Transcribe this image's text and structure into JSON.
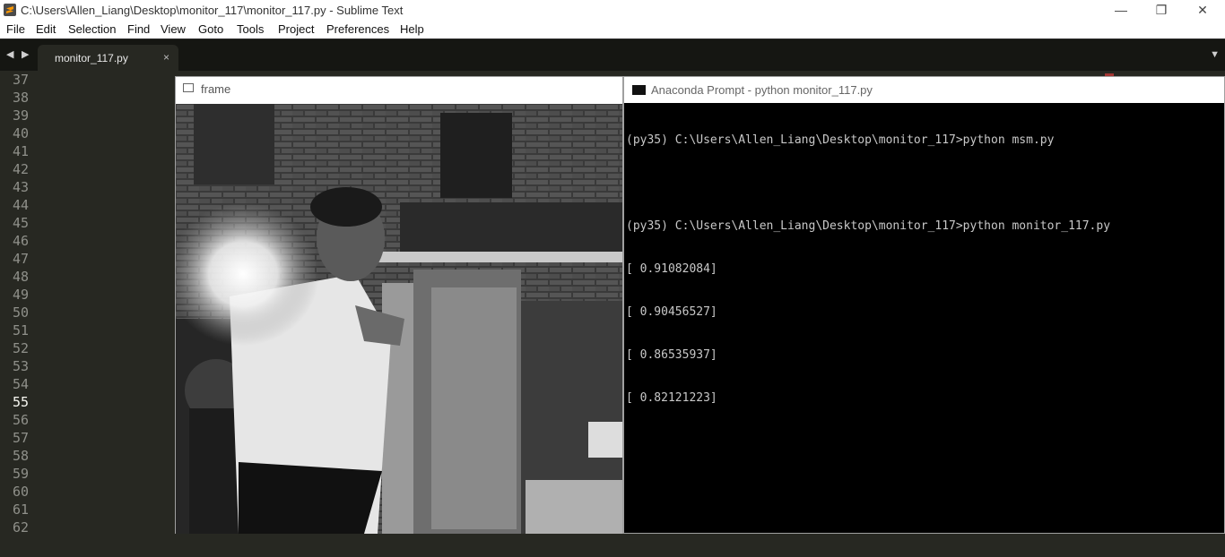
{
  "window": {
    "title": "C:\\Users\\Allen_Liang\\Desktop\\monitor_117\\monitor_117.py - Sublime Text",
    "controls": {
      "minimize": "—",
      "maximize": "❐",
      "close": "✕"
    }
  },
  "menu": [
    "File",
    "Edit",
    "Selection",
    "Find",
    "View",
    "Goto",
    "Tools",
    "Project",
    "Preferences",
    "Help"
  ],
  "tabs": {
    "nav_left": "◀",
    "nav_right": "▶",
    "active_tab": "monitor_117.py",
    "close_glyph": "×",
    "dropdown": "▼"
  },
  "editor": {
    "line_numbers": [
      "37",
      "38",
      "39",
      "40",
      "41",
      "42",
      "43",
      "44",
      "45",
      "46",
      "47",
      "48",
      "49",
      "50",
      "51",
      "52",
      "53",
      "54",
      "55",
      "56",
      "57",
      "58",
      "59",
      "60",
      "61",
      "62"
    ],
    "current_line": "55"
  },
  "frame_window": {
    "title": "frame"
  },
  "console_window": {
    "title": "Anaconda Prompt - python  monitor_117.py",
    "lines": [
      "(py35) C:\\Users\\Allen_Liang\\Desktop\\monitor_117>python msm.py",
      "",
      "(py35) C:\\Users\\Allen_Liang\\Desktop\\monitor_117>python monitor_117.py",
      "[ 0.91082084]",
      "[ 0.90456527]",
      "[ 0.86535937]",
      "[ 0.82121223]"
    ]
  },
  "colors": {
    "editor_bg": "#272822",
    "keyword": "#f92672",
    "def_keyword": "#66d9ef",
    "function": "#a6e22e",
    "number": "#ae81ff",
    "comment": "#75715e",
    "console_bg": "#000000"
  }
}
